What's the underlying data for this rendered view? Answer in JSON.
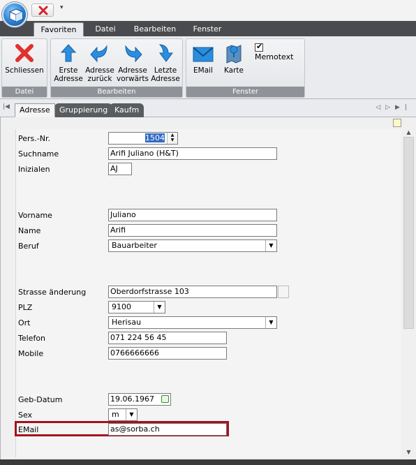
{
  "quick_access": {
    "menu_glyph": "▾"
  },
  "ribbon_tabs": [
    {
      "label": "Favoriten",
      "active": true
    },
    {
      "label": "Datei",
      "active": false
    },
    {
      "label": "Bearbeiten",
      "active": false
    },
    {
      "label": "Fenster",
      "active": false
    }
  ],
  "ribbon": {
    "groups": [
      {
        "label": "Datei"
      },
      {
        "label": "Bearbeiten"
      },
      {
        "label": "Fenster"
      }
    ],
    "buttons": {
      "close": "Schliessen",
      "first_line1": "Erste",
      "first_line2": "Adresse",
      "back_line1": "Adresse",
      "back_line2": "zurück",
      "forward_line1": "Adresse",
      "forward_line2": "vorwärts",
      "last_line1": "Letzte",
      "last_line2": "Adresse",
      "email": "EMail",
      "map": "Karte"
    },
    "memotext": {
      "label": "Memotext",
      "checked": true,
      "check_glyph": "✔"
    }
  },
  "doc_tabs": [
    {
      "label": "Adresse",
      "active": true
    },
    {
      "label": "Gruppierung",
      "active": false
    },
    {
      "label": "Kaufm",
      "active": false
    }
  ],
  "nav": {
    "first": "|◀",
    "controls": "◁▷▶|"
  },
  "form": {
    "pers_nr": {
      "label": "Pers.-Nr.",
      "value": "1504"
    },
    "suchname": {
      "label": "Suchname",
      "value": "Arifi Juliano (H&T)"
    },
    "initialen": {
      "label": "Inizialen",
      "value": "AJ"
    },
    "vorname": {
      "label": "Vorname",
      "value": "Juliano"
    },
    "name": {
      "label": "Name",
      "value": "Arifi"
    },
    "beruf": {
      "label": "Beruf",
      "value": "Bauarbeiter"
    },
    "strasse": {
      "label": "Strasse änderung",
      "value": "Oberdorfstrasse 103"
    },
    "plz": {
      "label": "PLZ",
      "value": "9100"
    },
    "ort": {
      "label": "Ort",
      "value": "Herisau"
    },
    "telefon": {
      "label": "Telefon",
      "value": "071 224 56 45"
    },
    "mobile": {
      "label": "Mobile",
      "value": "0766666666"
    },
    "geb_datum": {
      "label": "Geb-Datum",
      "value": "19.06.1967"
    },
    "sex": {
      "label": "Sex",
      "value": "m"
    },
    "email": {
      "label": "EMail",
      "value": "as@sorba.ch"
    }
  },
  "colors": {
    "accent_blue": "#2a7fd0",
    "highlight_red": "#a3121c",
    "ribbon_bg": "#e9ebee"
  }
}
